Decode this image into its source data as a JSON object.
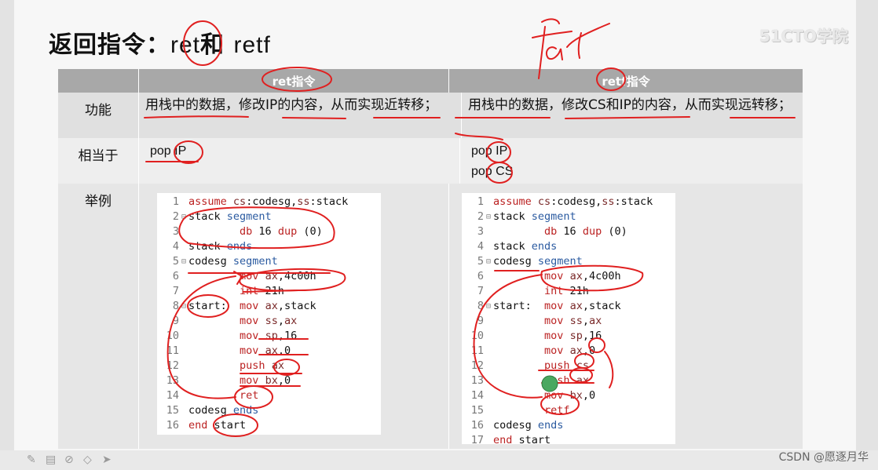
{
  "slide": {
    "title_prefix": "返回指令：",
    "title_ret": "ret",
    "title_and": "和",
    "title_retf": "retf",
    "watermark": "51CTO学院",
    "handwritten_note": "far"
  },
  "table": {
    "headers": [
      "",
      "ret指令",
      "retf指令"
    ],
    "rows": [
      {
        "label": "功能",
        "ret": "用栈中的数据，修改IP的内容，从而实现近转移；",
        "retf": "用栈中的数据，修改CS和IP的内容，从而实现远转移；"
      },
      {
        "label": "相当于",
        "ret": [
          "pop IP"
        ],
        "retf": [
          "pop IP",
          "pop CS"
        ]
      },
      {
        "label": "举例"
      }
    ]
  },
  "code1": [
    {
      "n": "1",
      "f": "",
      "t": "assume cs:codesg,ss:stack"
    },
    {
      "n": "2",
      "f": "⊟",
      "t": "stack segment"
    },
    {
      "n": "3",
      "f": "",
      "t": "        db 16 dup (0)"
    },
    {
      "n": "4",
      "f": "",
      "t": "stack ends"
    },
    {
      "n": "5",
      "f": "⊟",
      "t": "codesg segment"
    },
    {
      "n": "6",
      "f": "",
      "t": "        mov ax,4c00h"
    },
    {
      "n": "7",
      "f": "",
      "t": "        int 21h"
    },
    {
      "n": "8",
      "f": "⊟",
      "t": "start:  mov ax,stack"
    },
    {
      "n": "9",
      "f": "",
      "t": "        mov ss,ax"
    },
    {
      "n": "10",
      "f": "",
      "t": "        mov sp,16"
    },
    {
      "n": "11",
      "f": "",
      "t": "        mov ax,0"
    },
    {
      "n": "12",
      "f": "",
      "t": "        push ax"
    },
    {
      "n": "13",
      "f": "",
      "t": "        mov bx,0"
    },
    {
      "n": "14",
      "f": "",
      "t": "        ret"
    },
    {
      "n": "15",
      "f": "",
      "t": "codesg ends"
    },
    {
      "n": "16",
      "f": "",
      "t": "end start"
    }
  ],
  "code2": [
    {
      "n": "1",
      "f": "",
      "t": "assume cs:codesg,ss:stack"
    },
    {
      "n": "2",
      "f": "⊟",
      "t": "stack segment"
    },
    {
      "n": "3",
      "f": "",
      "t": "        db 16 dup (0)"
    },
    {
      "n": "4",
      "f": "",
      "t": "stack ends"
    },
    {
      "n": "5",
      "f": "⊟",
      "t": "codesg segment"
    },
    {
      "n": "6",
      "f": "",
      "t": "        mov ax,4c00h"
    },
    {
      "n": "7",
      "f": "",
      "t": "        int 21h"
    },
    {
      "n": "8",
      "f": "⊟",
      "t": "start:  mov ax,stack"
    },
    {
      "n": "9",
      "f": "",
      "t": "        mov ss,ax"
    },
    {
      "n": "10",
      "f": "",
      "t": "        mov sp,16"
    },
    {
      "n": "11",
      "f": "",
      "t": "        mov ax,0"
    },
    {
      "n": "12",
      "f": "",
      "t": "        push cs"
    },
    {
      "n": "13",
      "f": "",
      "t": "        push ax"
    },
    {
      "n": "14",
      "f": "",
      "t": "        mov bx,0"
    },
    {
      "n": "15",
      "f": "",
      "t": "        retf"
    },
    {
      "n": "16",
      "f": "",
      "t": "codesg ends"
    },
    {
      "n": "17",
      "f": "",
      "t": "end start"
    }
  ],
  "footer": {
    "credit": "CSDN @愿逐月华"
  },
  "colors": {
    "header_bg": "#a8a8a8",
    "annotation": "#e02020",
    "keyword": "#b22222",
    "segment": "#2a5aa0"
  },
  "icons": [
    "pen-icon",
    "slides-icon",
    "highlighter-icon",
    "eraser-icon",
    "pointer-icon"
  ]
}
